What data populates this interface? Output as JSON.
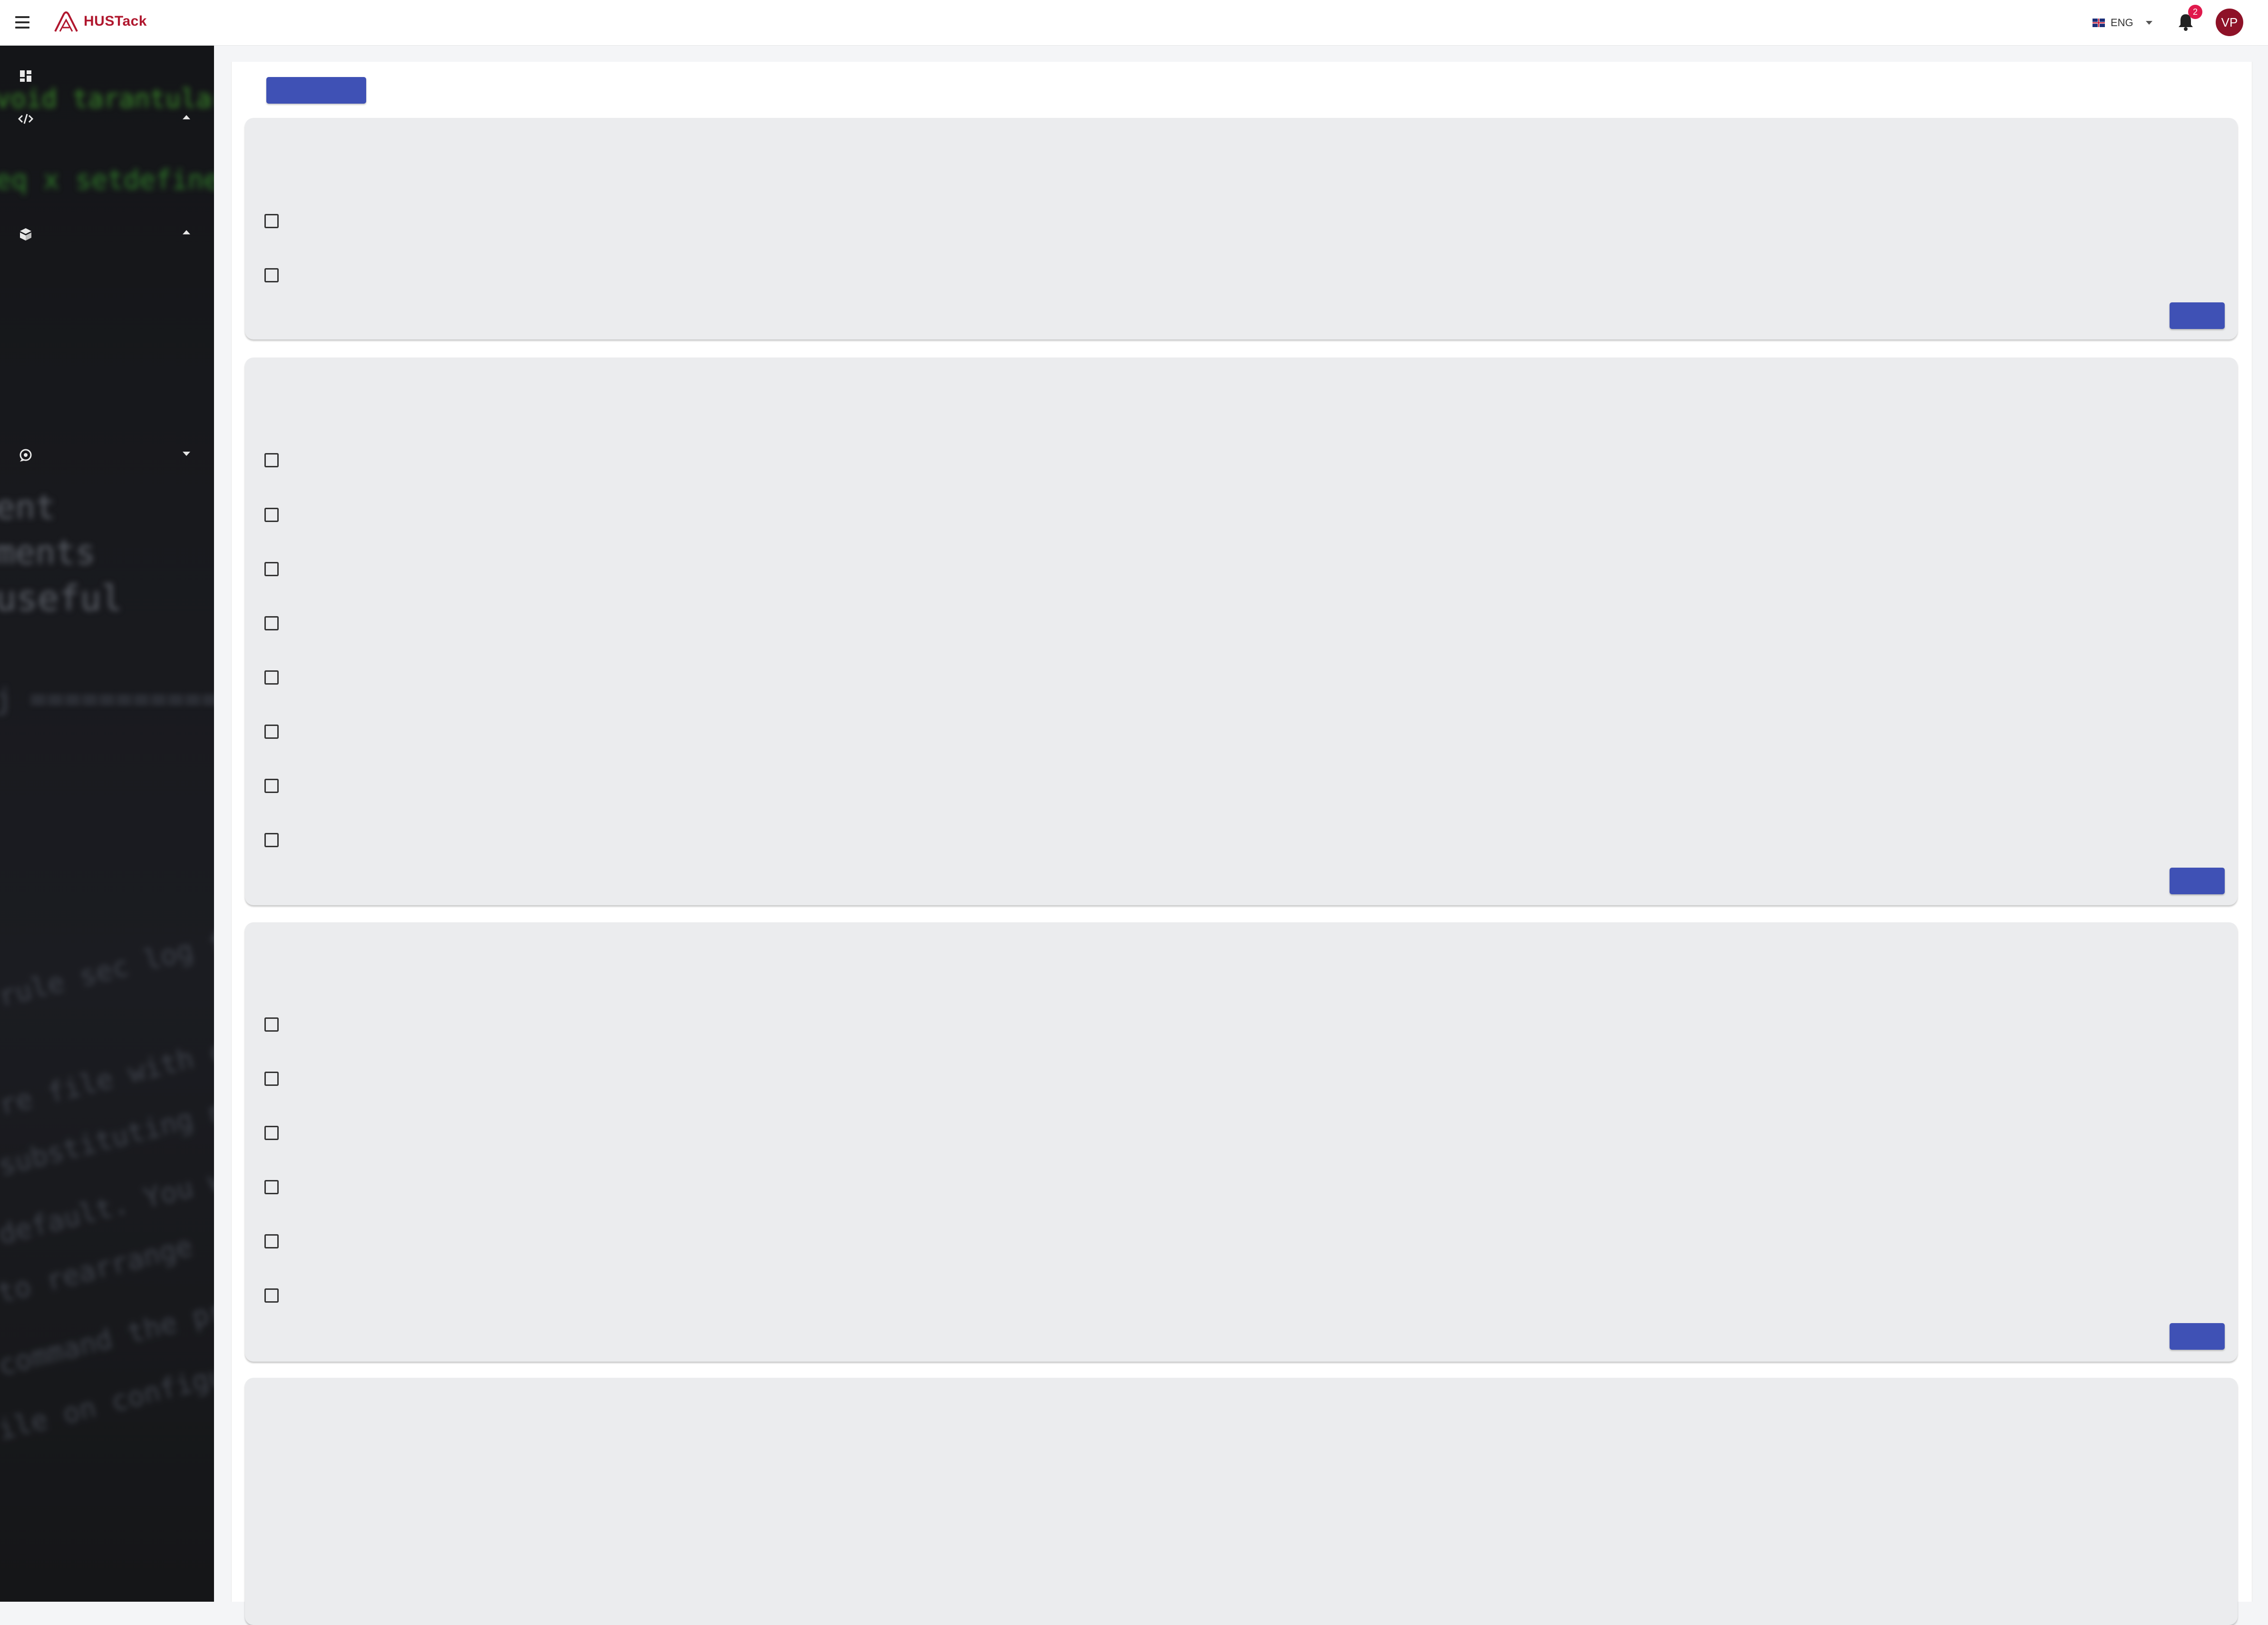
{
  "header": {
    "app_name": "HUSTack",
    "language": "ENG",
    "notification_count": "2",
    "user_initials": "VP"
  },
  "colors": {
    "brand": "#b0172e",
    "primary_button": "#3f51b5",
    "card_background": "#ebecee",
    "sidebar_background": "#17181c",
    "badge": "#e0194c",
    "avatar": "#8e1228"
  },
  "sidebar": {
    "items": [
      {
        "icon": "dashboard-icon",
        "expanded": null
      },
      {
        "icon": "code-icon",
        "expanded": true
      },
      {
        "icon": "education-icon",
        "expanded": true
      },
      {
        "icon": "support-icon",
        "expanded": false
      }
    ]
  },
  "main": {
    "top_button_label": "",
    "cards": [
      {
        "checkbox_count": 2,
        "button_label": ""
      },
      {
        "checkbox_count": 8,
        "button_label": ""
      },
      {
        "checkbox_count": 6,
        "button_label": ""
      },
      {
        "checkbox_count": 0,
        "button_label": ""
      }
    ]
  }
}
